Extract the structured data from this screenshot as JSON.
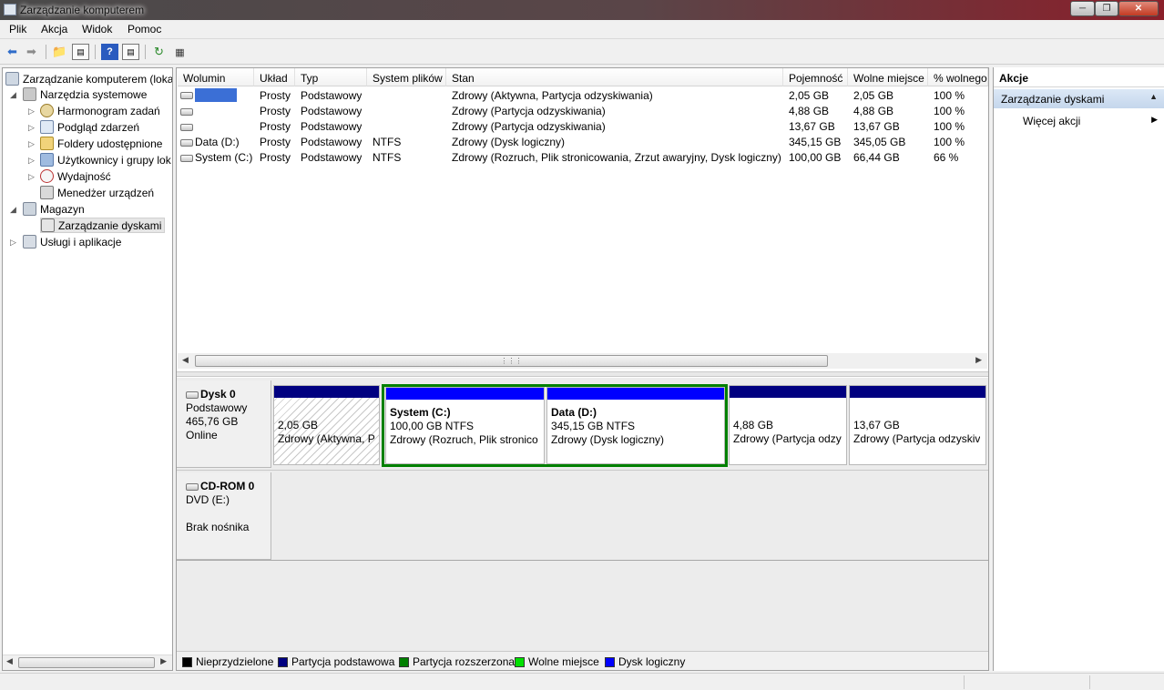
{
  "window": {
    "title": "Zarządzanie komputerem"
  },
  "menu": [
    "Plik",
    "Akcja",
    "Widok",
    "Pomoc"
  ],
  "tree": {
    "root": "Zarządzanie komputerem (lokal",
    "system_tools": "Narzędzia systemowe",
    "task_scheduler": "Harmonogram zadań",
    "event_viewer": "Podgląd zdarzeń",
    "shared_folders": "Foldery udostępnione",
    "users_groups": "Użytkownicy i grupy lok",
    "performance": "Wydajność",
    "device_manager": "Menedżer urządzeń",
    "storage": "Magazyn",
    "disk_management": "Zarządzanie dyskami",
    "services_apps": "Usługi i aplikacje"
  },
  "volume_table": {
    "headers": [
      "Wolumin",
      "Układ",
      "Typ",
      "System plików",
      "Stan",
      "Pojemność",
      "Wolne miejsce",
      "% wolnego"
    ],
    "rows": [
      [
        "",
        "Prosty",
        "Podstawowy",
        "",
        "Zdrowy (Aktywna, Partycja odzyskiwania)",
        "2,05 GB",
        "2,05 GB",
        "100 %"
      ],
      [
        "",
        "Prosty",
        "Podstawowy",
        "",
        "Zdrowy (Partycja odzyskiwania)",
        "4,88 GB",
        "4,88 GB",
        "100 %"
      ],
      [
        "",
        "Prosty",
        "Podstawowy",
        "",
        "Zdrowy (Partycja odzyskiwania)",
        "13,67 GB",
        "13,67 GB",
        "100 %"
      ],
      [
        "Data (D:)",
        "Prosty",
        "Podstawowy",
        "NTFS",
        "Zdrowy (Dysk logiczny)",
        "345,15 GB",
        "345,05 GB",
        "100 %"
      ],
      [
        "System (C:)",
        "Prosty",
        "Podstawowy",
        "NTFS",
        "Zdrowy (Rozruch, Plik stronicowania, Zrzut awaryjny, Dysk logiczny)",
        "100,00 GB",
        "66,44 GB",
        "66 %"
      ]
    ]
  },
  "disk0": {
    "name": "Dysk 0",
    "type": "Podstawowy",
    "size": "465,76 GB",
    "status": "Online",
    "partitions": [
      {
        "title": "",
        "size": "2,05 GB",
        "status": "Zdrowy (Aktywna, P"
      },
      {
        "title": "System  (C:)",
        "size": "100,00 GB NTFS",
        "status": "Zdrowy (Rozruch, Plik stronico"
      },
      {
        "title": "Data  (D:)",
        "size": "345,15 GB NTFS",
        "status": "Zdrowy (Dysk logiczny)"
      },
      {
        "title": "",
        "size": "4,88 GB",
        "status": "Zdrowy (Partycja odzy"
      },
      {
        "title": "",
        "size": "13,67 GB",
        "status": "Zdrowy (Partycja odzyskiv"
      }
    ]
  },
  "cdrom0": {
    "name": "CD-ROM 0",
    "type": "DVD (E:)",
    "status": "Brak nośnika"
  },
  "legend": [
    {
      "label": "Nieprzydzielone",
      "color": "#000000"
    },
    {
      "label": "Partycja podstawowa",
      "color": "#000080"
    },
    {
      "label": "Partycja rozszerzona",
      "color": "#008000"
    },
    {
      "label": "Wolne miejsce",
      "color": "#00e000"
    },
    {
      "label": "Dysk logiczny",
      "color": "#0000ff"
    }
  ],
  "actions": {
    "header": "Akcje",
    "section": "Zarządzanie dyskami",
    "more": "Więcej akcji"
  },
  "colors": {
    "primary": "#000080",
    "logical": "#0000ff",
    "extended": "#008000",
    "selection": "#3b6fd6"
  }
}
